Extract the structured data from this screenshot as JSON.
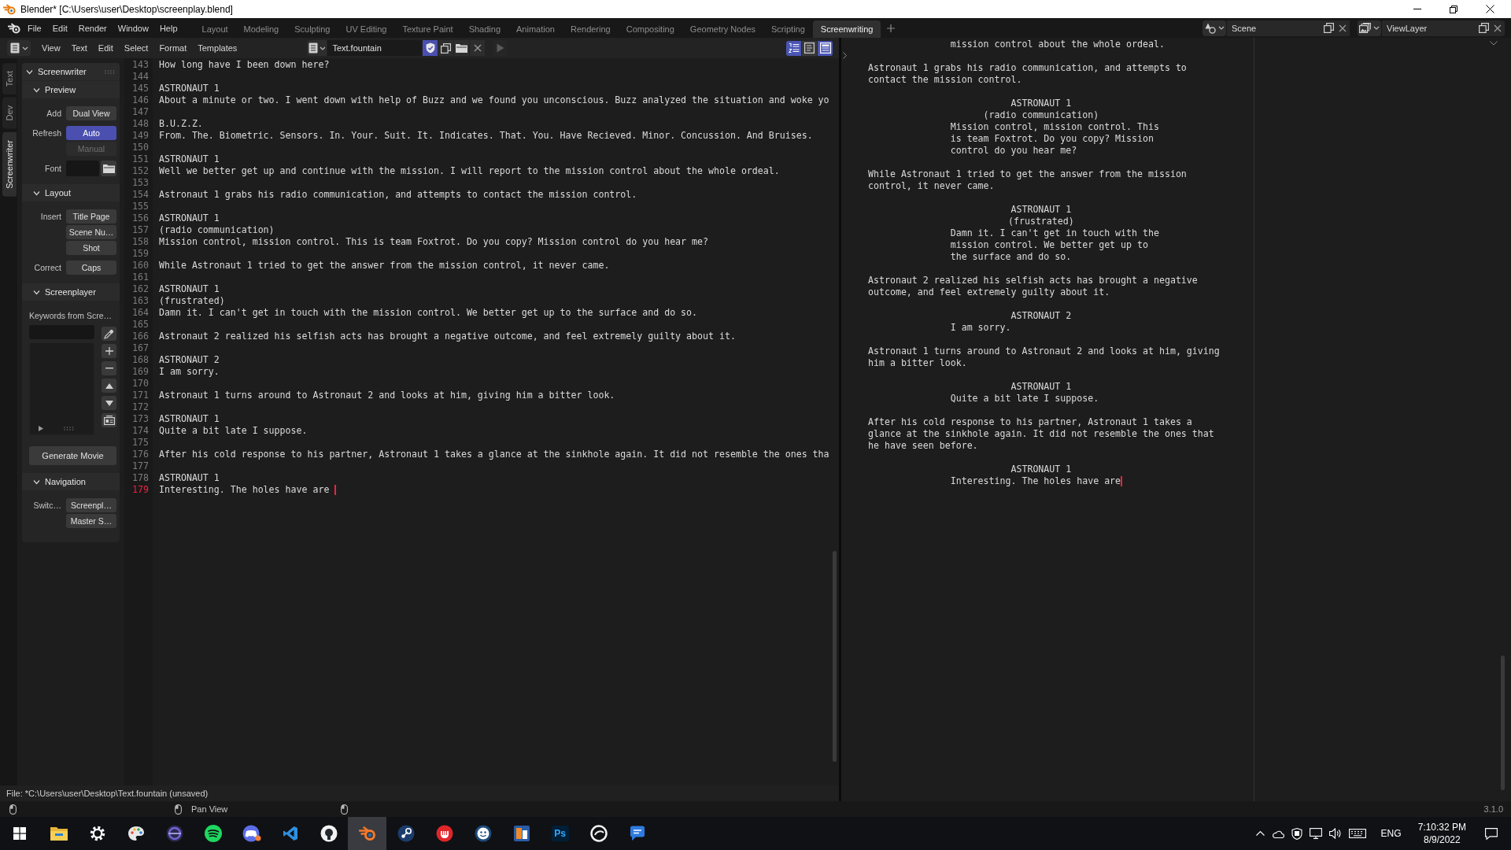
{
  "window": {
    "title": "Blender* [C:\\Users\\user\\Desktop\\screenplay.blend]"
  },
  "top_bar": {
    "menus": [
      "File",
      "Edit",
      "Render",
      "Window",
      "Help"
    ],
    "workspaces": [
      {
        "label": "Layout",
        "selected": false
      },
      {
        "label": "Modeling",
        "selected": false
      },
      {
        "label": "Sculpting",
        "selected": false
      },
      {
        "label": "UV Editing",
        "selected": false
      },
      {
        "label": "Texture Paint",
        "selected": false
      },
      {
        "label": "Shading",
        "selected": false
      },
      {
        "label": "Animation",
        "selected": false
      },
      {
        "label": "Rendering",
        "selected": false
      },
      {
        "label": "Compositing",
        "selected": false
      },
      {
        "label": "Geometry Nodes",
        "selected": false
      },
      {
        "label": "Scripting",
        "selected": false
      },
      {
        "label": "Screenwriting",
        "selected": true
      }
    ],
    "scene": "Scene",
    "view_layer": "ViewLayer"
  },
  "text_editor": {
    "header": {
      "menus": [
        "View",
        "Text",
        "Edit",
        "Select",
        "Format",
        "Templates"
      ],
      "text_name": "Text.fountain",
      "fake_user": true,
      "run_disabled": true,
      "toggles": [
        {
          "kind": "line-numbers",
          "on": true
        },
        {
          "kind": "word-wrap",
          "on": false
        },
        {
          "kind": "syntax",
          "on": true
        }
      ]
    },
    "sidebar_tabs": [
      {
        "label": "Text",
        "selected": false
      },
      {
        "label": "Dev",
        "selected": false
      },
      {
        "label": "Screenwriter",
        "selected": true
      }
    ],
    "panel": {
      "title": "Screenwriter",
      "expanded": true,
      "sections": [
        {
          "title": "Preview",
          "expanded": true,
          "rows": [
            {
              "kind": "buttons",
              "label": "Add",
              "buttons": [
                "Dual View"
              ]
            },
            {
              "kind": "toggle",
              "label": "Refresh",
              "buttons": [
                {
                  "label": "Auto",
                  "on": true,
                  "disabled": false
                },
                {
                  "label": "Manual",
                  "on": false,
                  "disabled": true
                }
              ]
            },
            {
              "kind": "file",
              "label": "Font"
            }
          ]
        },
        {
          "title": "Layout",
          "expanded": true,
          "rows": [
            {
              "kind": "buttons",
              "label": "Insert",
              "buttons": [
                "Title Page",
                "Scene Nu…",
                "Shot"
              ]
            },
            {
              "kind": "buttons",
              "label": "Correct",
              "buttons": [
                "Caps"
              ]
            }
          ]
        },
        {
          "title": "Screenplayer",
          "expanded": true,
          "rows": [
            {
              "kind": "list",
              "label": "Keywords from Scre…"
            },
            {
              "kind": "wide-button",
              "label": "Generate Movie"
            }
          ]
        },
        {
          "title": "Navigation",
          "expanded": true,
          "rows": [
            {
              "kind": "buttons",
              "label": "Switc…",
              "buttons": [
                "Screenpl…",
                "Master S…"
              ]
            }
          ]
        }
      ]
    },
    "lines": [
      {
        "number": "143",
        "text": "How long have I been down here?",
        "current": false
      },
      {
        "number": "144",
        "current": false
      },
      {
        "number": "145",
        "text": "ASTRONAUT 1",
        "current": false
      },
      {
        "number": "146",
        "text": "About a minute or two. I went down with help of Buzz and we found you unconscious. Buzz analyzed the situation and woke yo",
        "current": false
      },
      {
        "number": "147",
        "current": false
      },
      {
        "number": "148",
        "text": "B.U.Z.Z.",
        "current": false
      },
      {
        "number": "149",
        "text": "From. The. Biometric. Sensors. In. Your. Suit. It. Indicates. That. You. Have Recieved. Minor. Concussion. And Bruises.",
        "current": false
      },
      {
        "number": "150",
        "current": false
      },
      {
        "number": "151",
        "text": "ASTRONAUT 1",
        "current": false
      },
      {
        "number": "152",
        "text": "Well we better get up and continue with the mission. I will report to the mission control about the whole ordeal.",
        "current": false
      },
      {
        "number": "153",
        "current": false
      },
      {
        "number": "154",
        "text": "Astronaut 1 grabs his radio communication, and attempts to contact the mission control.",
        "current": false
      },
      {
        "number": "155",
        "current": false
      },
      {
        "number": "156",
        "text": "ASTRONAUT 1",
        "current": false
      },
      {
        "number": "157",
        "text": "(radio communication)",
        "current": false
      },
      {
        "number": "158",
        "text": "Mission control, mission control. This is team Foxtrot. Do you copy? Mission control do you hear me?",
        "current": false
      },
      {
        "number": "159",
        "current": false
      },
      {
        "number": "160",
        "text": "While Astronaut 1 tried to get the answer from the mission control, it never came.",
        "current": false
      },
      {
        "number": "161",
        "current": false
      },
      {
        "number": "162",
        "text": "ASTRONAUT 1",
        "current": false
      },
      {
        "number": "163",
        "text": "(frustrated)",
        "current": false
      },
      {
        "number": "164",
        "text": "Damn it. I can't get in touch with the mission control. We better get up to the surface and do so.",
        "current": false
      },
      {
        "number": "165",
        "current": false
      },
      {
        "number": "166",
        "text": "Astronaut 2 realized his selfish acts has brought a negative outcome, and feel extremely guilty about it.",
        "current": false
      },
      {
        "number": "167",
        "current": false
      },
      {
        "number": "168",
        "text": "ASTRONAUT 2",
        "current": false
      },
      {
        "number": "169",
        "text": "I am sorry.",
        "current": false
      },
      {
        "number": "170",
        "current": false
      },
      {
        "number": "171",
        "text": "Astronaut 1 turns around to Astronaut 2 and looks at him, giving him a bitter look.",
        "current": false
      },
      {
        "number": "172",
        "current": false
      },
      {
        "number": "173",
        "text": "ASTRONAUT 1",
        "current": false
      },
      {
        "number": "174",
        "text": "Quite a bit late I suppose.",
        "current": false
      },
      {
        "number": "175",
        "current": false
      },
      {
        "number": "176",
        "text": "After his cold response to his partner, Astronaut 1 takes a glance at the sinkhole again. It did not resemble the ones tha",
        "current": false
      },
      {
        "number": "177",
        "current": false
      },
      {
        "number": "178",
        "text": "ASTRONAUT 1",
        "current": false
      },
      {
        "number": "179",
        "text": "Interesting. The holes have are ",
        "current": true
      }
    ],
    "footer": "File: *C:\\Users\\user\\Desktop\\Text.fountain (unsaved)"
  },
  "preview": {
    "blocks": [
      {
        "kind": "dialogue",
        "lines": [
          "mission control about the whole ordeal."
        ],
        "current": false
      },
      {
        "kind": "action",
        "lines": [
          "Astronaut 1 grabs his radio communication, and attempts to",
          "contact the mission control."
        ],
        "current": false
      },
      {
        "kind": "character",
        "lines": [
          "ASTRONAUT 1"
        ],
        "current": false
      },
      {
        "kind": "parenthetical",
        "lines": [
          "(radio communication)"
        ],
        "current": false
      },
      {
        "kind": "dialogue",
        "lines": [
          "Mission control, mission control. This",
          "is team Foxtrot. Do you copy? Mission",
          "control do you hear me?"
        ],
        "current": false
      },
      {
        "kind": "action",
        "lines": [
          "While Astronaut 1 tried to get the answer from the mission",
          "control, it never came."
        ],
        "current": false
      },
      {
        "kind": "character",
        "lines": [
          "ASTRONAUT 1"
        ],
        "current": false
      },
      {
        "kind": "parenthetical",
        "lines": [
          "(frustrated)"
        ],
        "current": false
      },
      {
        "kind": "dialogue",
        "lines": [
          "Damn it. I can't get in touch with the",
          "mission control. We better get up to",
          "the surface and do so."
        ],
        "current": false
      },
      {
        "kind": "action",
        "lines": [
          "Astronaut 2 realized his selfish acts has brought a negative",
          "outcome, and feel extremely guilty about it."
        ],
        "current": false
      },
      {
        "kind": "character",
        "lines": [
          "ASTRONAUT 2"
        ],
        "current": false
      },
      {
        "kind": "dialogue",
        "lines": [
          "I am sorry."
        ],
        "current": false
      },
      {
        "kind": "action",
        "lines": [
          "Astronaut 1 turns around to Astronaut 2 and looks at him, giving",
          "him a bitter look."
        ],
        "current": false
      },
      {
        "kind": "character",
        "lines": [
          "ASTRONAUT 1"
        ],
        "current": false
      },
      {
        "kind": "dialogue",
        "lines": [
          "Quite a bit late I suppose."
        ],
        "current": false
      },
      {
        "kind": "action",
        "lines": [
          "After his cold response to his partner, Astronaut 1 takes a",
          "glance at the sinkhole again. It did not resemble the ones that",
          "he have seen before."
        ],
        "current": false
      },
      {
        "kind": "character",
        "lines": [
          "ASTRONAUT 1"
        ],
        "current": false
      },
      {
        "kind": "dialogue",
        "lines": [
          "Interesting. The holes have are"
        ],
        "current": true
      }
    ]
  },
  "status_bar": {
    "hint": "Pan View",
    "version": "3.1.0"
  },
  "taskbar": {
    "apps": [
      {
        "kind": "explorer",
        "active": false
      },
      {
        "kind": "settings",
        "active": false
      },
      {
        "kind": "paint",
        "active": false
      },
      {
        "kind": "disc",
        "active": false
      },
      {
        "kind": "music",
        "active": false
      },
      {
        "kind": "chat",
        "active": false
      },
      {
        "kind": "code",
        "active": false
      },
      {
        "kind": "cat",
        "active": false
      },
      {
        "kind": "blender",
        "active": true
      },
      {
        "kind": "steam",
        "active": false
      },
      {
        "kind": "red",
        "active": false
      },
      {
        "kind": "smiley",
        "active": false
      },
      {
        "kind": "square",
        "active": false
      },
      {
        "kind": "ps",
        "label": "Ps",
        "active": false
      },
      {
        "kind": "ring",
        "active": false
      },
      {
        "kind": "bubble",
        "active": false
      }
    ],
    "tray": {
      "language": "ENG",
      "time": "7:10:32 PM",
      "date": "8/9/2022"
    }
  }
}
